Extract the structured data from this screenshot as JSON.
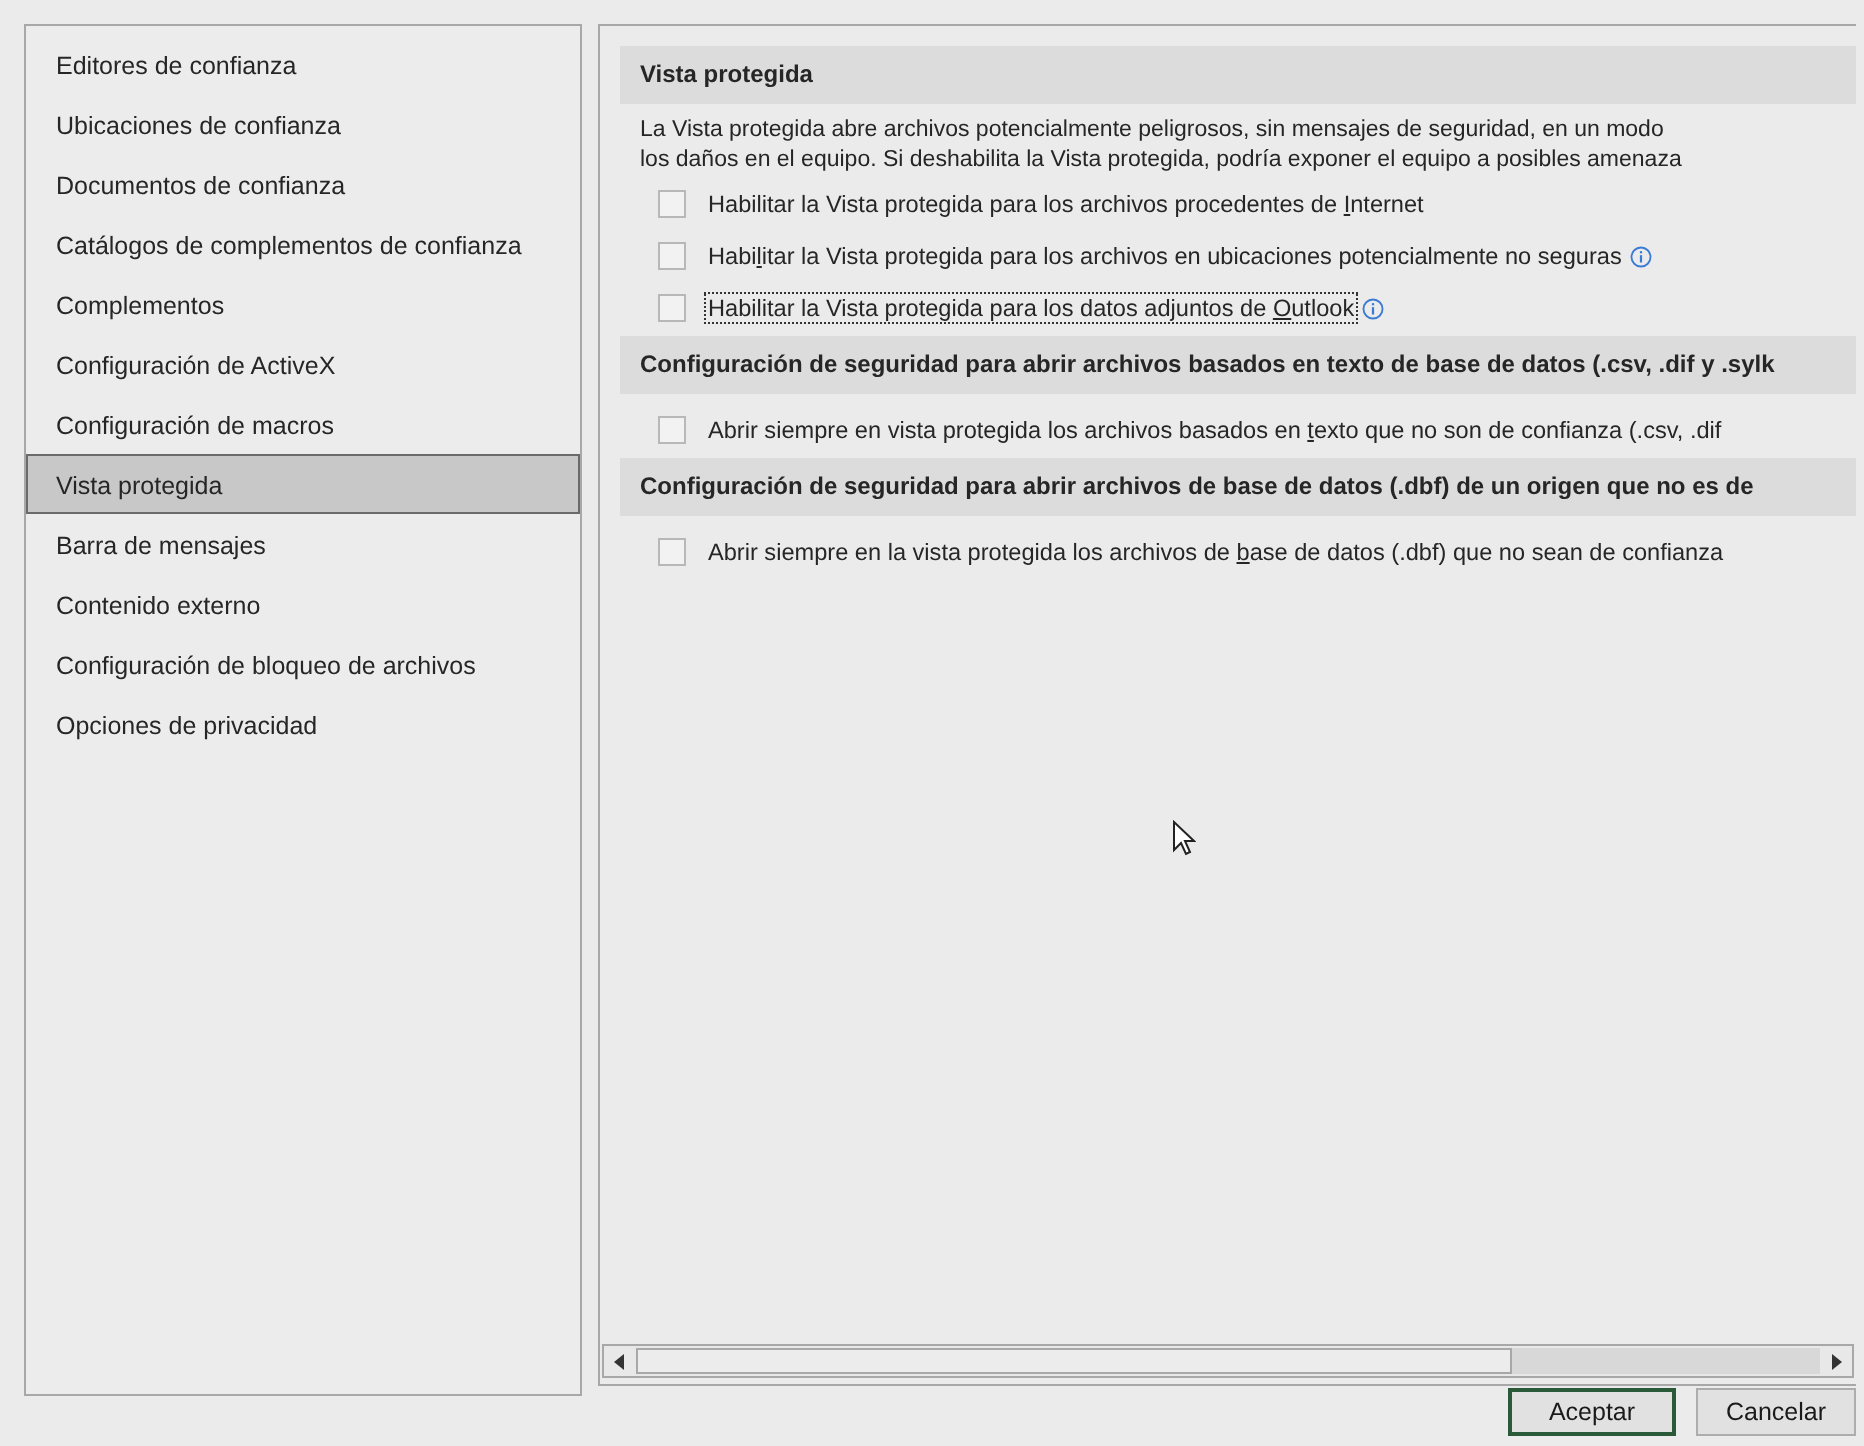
{
  "sidebar": {
    "items": [
      {
        "label": "Editores de confianza",
        "selected": false
      },
      {
        "label": "Ubicaciones de confianza",
        "selected": false
      },
      {
        "label": "Documentos de confianza",
        "selected": false
      },
      {
        "label": "Catálogos de complementos de confianza",
        "selected": false
      },
      {
        "label": "Complementos",
        "selected": false
      },
      {
        "label": "Configuración de ActiveX",
        "selected": false
      },
      {
        "label": "Configuración de macros",
        "selected": false
      },
      {
        "label": "Vista protegida",
        "selected": true
      },
      {
        "label": "Barra de mensajes",
        "selected": false
      },
      {
        "label": "Contenido externo",
        "selected": false
      },
      {
        "label": "Configuración de bloqueo de archivos",
        "selected": false
      },
      {
        "label": "Opciones de privacidad",
        "selected": false
      }
    ]
  },
  "sections": [
    {
      "title": "Vista protegida",
      "description": [
        "La Vista protegida abre archivos potencialmente peligrosos, sin mensajes de seguridad, en un modo",
        "los daños en el equipo. Si deshabilita la Vista protegida, podría exponer el equipo a posibles amenaza"
      ],
      "options": [
        {
          "before": "Habilitar la Vista protegida para los archivos procedentes de ",
          "key": "I",
          "after": "nternet",
          "checked": false,
          "focused": false,
          "info": false
        },
        {
          "before": "Habi",
          "key": "l",
          "after": "itar la Vista protegida para los archivos en ubicaciones potencialmente no seguras",
          "checked": false,
          "focused": false,
          "info": true
        },
        {
          "before": "Habilitar la Vista protegida para los datos adjuntos de ",
          "key": "O",
          "after": "utlook",
          "checked": false,
          "focused": true,
          "info": true
        }
      ]
    },
    {
      "title": "Configuración de seguridad para abrir archivos basados en texto de base de datos (.csv, .dif y .sylk",
      "options": [
        {
          "before": "Abrir siempre en vista protegida los archivos basados en ",
          "key": "t",
          "after": "exto que no son de confianza (.csv, .dif",
          "checked": false,
          "focused": false,
          "info": false
        }
      ]
    },
    {
      "title": "Configuración de seguridad para abrir archivos de base de datos (.dbf) de un origen que no es de",
      "options": [
        {
          "before": "Abrir siempre en la vista protegida los archivos de ",
          "key": "b",
          "after": "ase de datos (.dbf) que no sean de confianza",
          "checked": false,
          "focused": false,
          "info": false
        }
      ]
    }
  ],
  "buttons": [
    {
      "label": "Aceptar",
      "default": true
    },
    {
      "label": "Cancelar",
      "default": false
    }
  ]
}
